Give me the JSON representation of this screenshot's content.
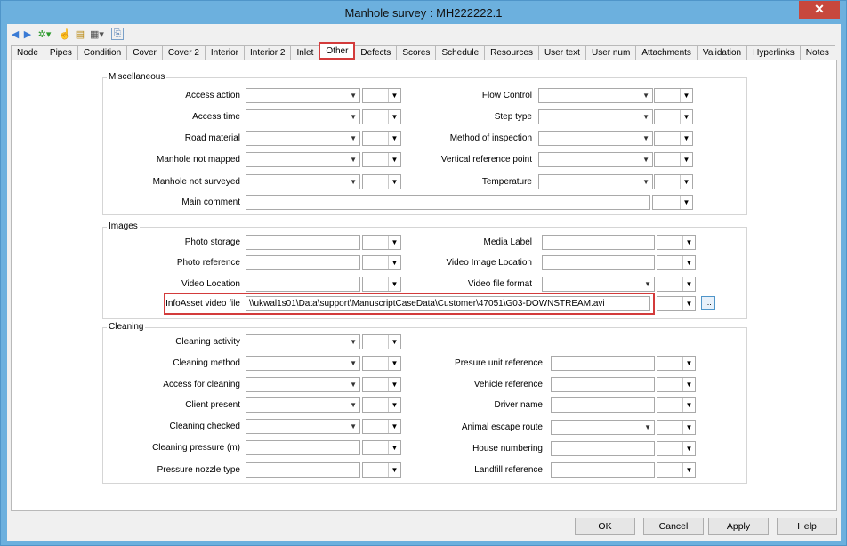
{
  "window": {
    "title": "Manhole survey : MH222222.1",
    "close_glyph": "✕"
  },
  "toolbar": {
    "icons": [
      "back-arrow-icon",
      "forward-arrow-icon",
      "settings-icon",
      "pointer-icon",
      "notes-icon",
      "film-icon",
      "attach-icon"
    ]
  },
  "tabs": [
    "Node",
    "Pipes",
    "Condition",
    "Cover",
    "Cover 2",
    "Interior",
    "Interior 2",
    "Inlet",
    "Other",
    "Defects",
    "Scores",
    "Schedule",
    "Resources",
    "User text",
    "User num",
    "Attachments",
    "Validation",
    "Hyperlinks",
    "Notes"
  ],
  "active_tab": "Other",
  "misc": {
    "title": "Miscellaneous",
    "access_action": "Access action",
    "access_time": "Access time",
    "road_material": "Road material",
    "manhole_not_mapped": "Manhole not mapped",
    "manhole_not_surveyed": "Manhole not surveyed",
    "main_comment": "Main comment",
    "flow_control": "Flow Control",
    "step_type": "Step type",
    "method_of_inspection": "Method of inspection",
    "vertical_reference_point": "Vertical reference point",
    "temperature": "Temperature"
  },
  "images": {
    "title": "Images",
    "photo_storage": "Photo storage",
    "photo_reference": "Photo reference",
    "video_location": "Video Location",
    "infoasset_video_file": "InfoAsset video file",
    "infoasset_video_value": "\\\\ukwal1s01\\Data\\support\\ManuscriptCaseData\\Customer\\47051\\G03-DOWNSTREAM.avi",
    "media_label": "Media Label",
    "video_image_location": "Video Image Location",
    "video_file_format": "Video file format",
    "browse_label": "..."
  },
  "cleaning": {
    "title": "Cleaning",
    "cleaning_activity": "Cleaning activity",
    "cleaning_method": "Cleaning method",
    "access_for_cleaning": "Access for cleaning",
    "client_present": "Client present",
    "cleaning_checked": "Cleaning checked",
    "cleaning_pressure": "Cleaning pressure (m)",
    "pressure_nozzle_type": "Pressure nozzle type",
    "presure_unit_reference": "Presure unit reference",
    "vehicle_reference": "Vehicle reference",
    "driver_name": "Driver name",
    "animal_escape_route": "Animal escape route",
    "house_numbering": "House numbering",
    "landfill_reference": "Landfill reference"
  },
  "buttons": {
    "ok": "OK",
    "cancel": "Cancel",
    "apply": "Apply",
    "help": "Help"
  }
}
